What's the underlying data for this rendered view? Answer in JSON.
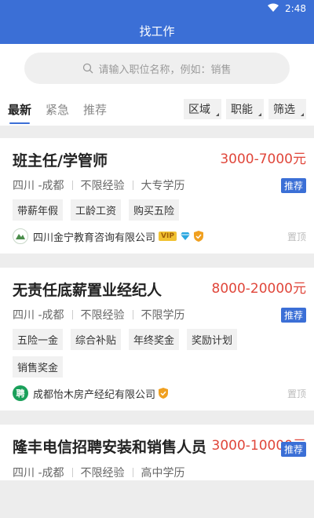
{
  "status": {
    "time": "2:48"
  },
  "header": {
    "title": "找工作"
  },
  "search": {
    "placeholder": "请输入职位名称，例如：销售"
  },
  "tabs": [
    {
      "label": "最新",
      "active": true
    },
    {
      "label": "紧急"
    },
    {
      "label": "推荐"
    }
  ],
  "filters": [
    {
      "label": "区域"
    },
    {
      "label": "职能"
    },
    {
      "label": "筛选"
    }
  ],
  "jobs": [
    {
      "title": "班主任/学管师",
      "salary": "3000-7000元",
      "location": "四川 -成都",
      "experience": "不限经验",
      "education": "大专学历",
      "badge": "推荐",
      "tags": [
        "带薪年假",
        "工龄工资",
        "购买五险"
      ],
      "company": "四川金宁教育咨询有限公司",
      "vip_label": "VIP",
      "pin": "置顶"
    },
    {
      "title": "无责任底薪置业经纪人",
      "salary": "8000-20000元",
      "location": "四川 -成都",
      "experience": "不限经验",
      "education": "不限学历",
      "badge": "推荐",
      "tags": [
        "五险一金",
        "综合补贴",
        "年终奖金",
        "奖励计划",
        "销售奖金"
      ],
      "company": "成都怡木房产经纪有限公司",
      "logo_text": "聘",
      "pin": "置顶"
    },
    {
      "title": "隆丰电信招聘安装和销售人员",
      "salary": "3000-10000元",
      "location": "四川 -成都",
      "experience": "不限经验",
      "education": "高中学历",
      "badge": "推荐"
    }
  ],
  "colors": {
    "primary": "#3b6fd6",
    "salary": "#e0463a"
  }
}
